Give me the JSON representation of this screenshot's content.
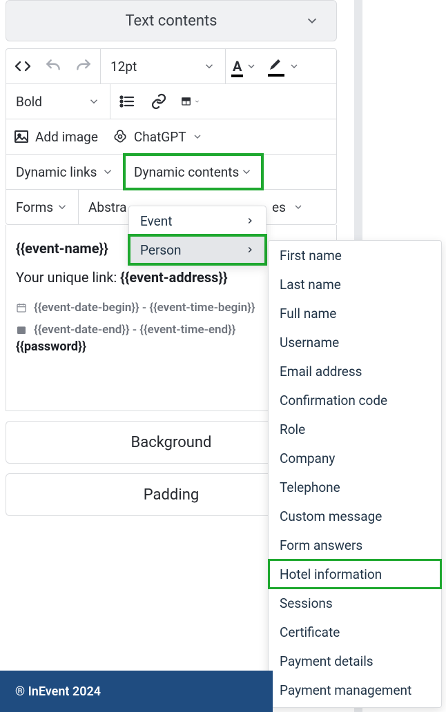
{
  "section": {
    "title": "Text contents"
  },
  "toolbar": {
    "font_size": "12pt",
    "font_weight": "Bold",
    "add_image": "Add image",
    "chatgpt": "ChatGPT",
    "dynamic_links": "Dynamic links",
    "dynamic_contents": "Dynamic contents",
    "forms": "Forms",
    "abstract": "Abstra",
    "trailing_frag": "es"
  },
  "menu_dynamic_contents": {
    "items": [
      "Event",
      "Person"
    ],
    "highlighted": "Person"
  },
  "menu_person": {
    "items": [
      "First name",
      "Last name",
      "Full name",
      "Username",
      "Email address",
      "Confirmation code",
      "Role",
      "Company",
      "Telephone",
      "Custom message",
      "Form answers",
      "Hotel information",
      "Sessions",
      "Certificate",
      "Payment details",
      "Payment management"
    ],
    "highlighted": "Hotel information"
  },
  "editor": {
    "line1": "{{event-name}}",
    "line2_label": "Your unique link: ",
    "line2_value": "{{event-address}}",
    "line3": "{{event-date-begin}} - {{event-time-begin}}",
    "line4": "{{event-date-end}} - {{event-time-end}}",
    "line5": "{{password}}"
  },
  "sections": {
    "background": "Background",
    "padding": "Padding"
  },
  "footer": "® InEvent 2024"
}
